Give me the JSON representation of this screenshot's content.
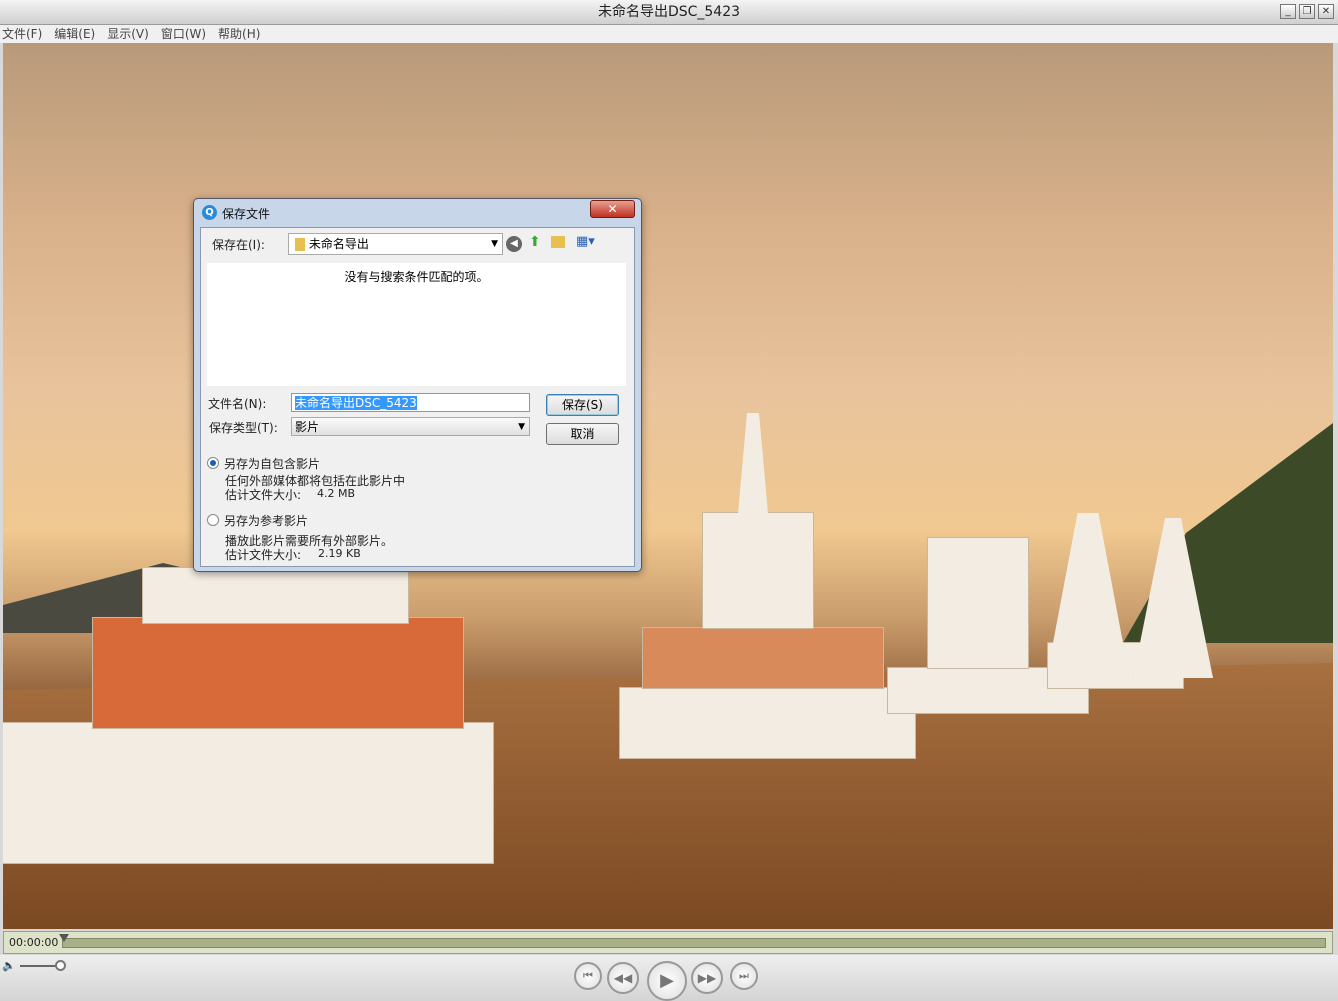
{
  "window": {
    "title": "未命名导出DSC_5423",
    "minimize": "_",
    "restore": "❐",
    "close": "✕"
  },
  "menu": [
    "文件(F)",
    "编辑(E)",
    "显示(V)",
    "窗口(W)",
    "帮助(H)"
  ],
  "player": {
    "timecode": "00:00:00",
    "progress": 0,
    "volume": 1.0
  },
  "dialog": {
    "title": "保存文件",
    "save_in_label": "保存在(I):",
    "save_in_value": "未命名导出",
    "empty_message": "没有与搜索条件匹配的项。",
    "filename_label": "文件名(N):",
    "filename_value": "未命名导出DSC_5423",
    "filetype_label": "保存类型(T):",
    "filetype_value": "影片",
    "save_button": "保存(S)",
    "cancel_button": "取消",
    "options": [
      {
        "label": "另存为自包含影片",
        "desc": "任何外部媒体都将包括在此影片中",
        "size_label": "估计文件大小:",
        "size": "4.2 MB",
        "selected": true
      },
      {
        "label": "另存为参考影片",
        "desc": "播放此影片需要所有外部影片。",
        "size_label": "估计文件大小:",
        "size": "2.19 KB",
        "selected": false
      }
    ]
  }
}
